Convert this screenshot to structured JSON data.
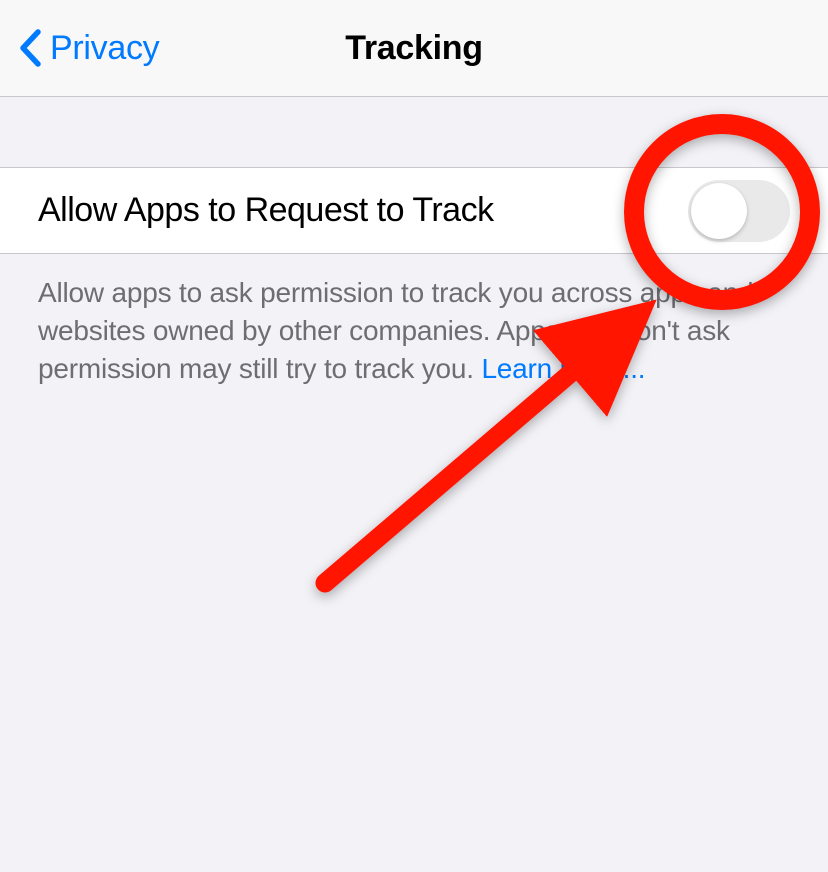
{
  "navbar": {
    "back_label": "Privacy",
    "title": "Tracking"
  },
  "setting": {
    "allow_track_label": "Allow Apps to Request to Track",
    "toggle_state": "off"
  },
  "footer": {
    "description": "Allow apps to ask permission to track you across apps and websites owned by other companies. Apps that don't ask permission may still try to track you. ",
    "learn_more_label": "Learn more..."
  },
  "annotation": {
    "circle_color": "#ff1500",
    "arrow_color": "#ff1500"
  }
}
